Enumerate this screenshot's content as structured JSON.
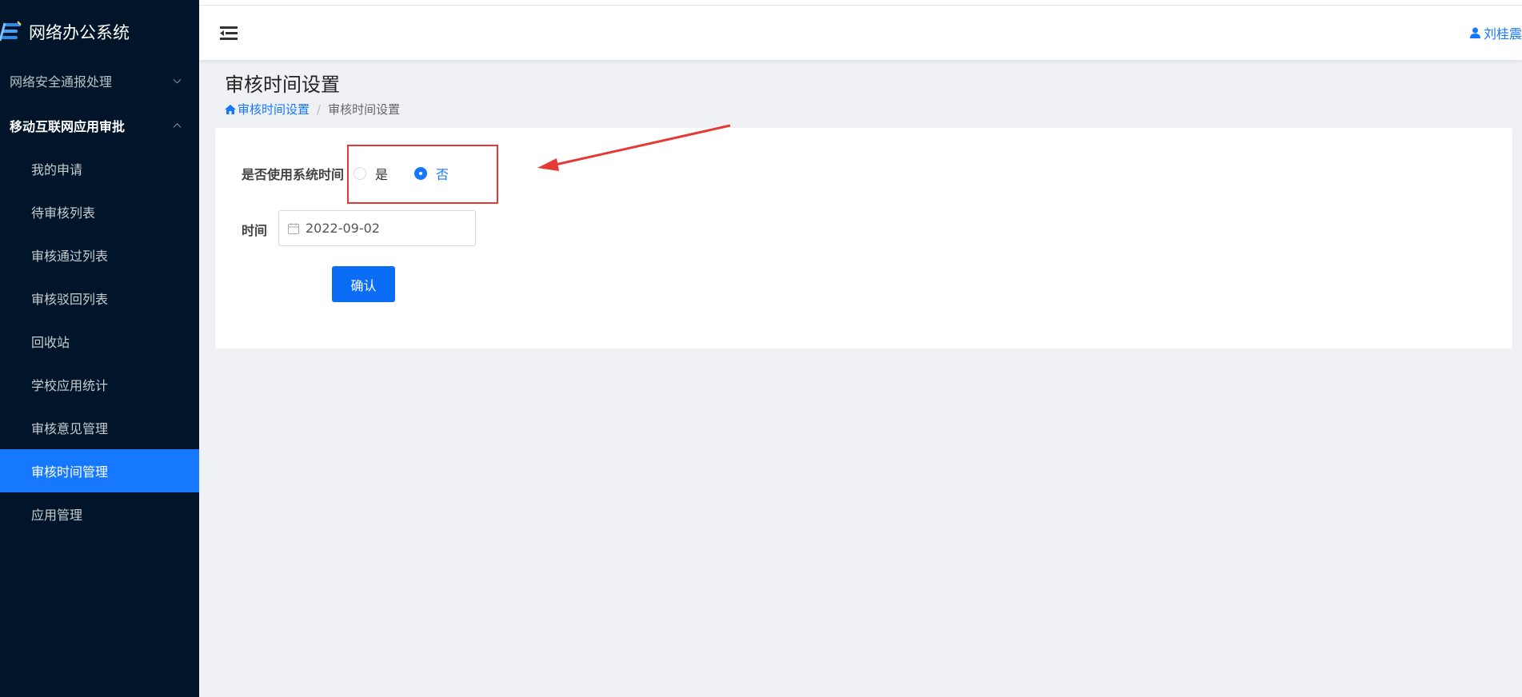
{
  "app": {
    "title": "网络办公系统"
  },
  "sidebar": {
    "groups": [
      {
        "label": "网络安全通报处理"
      },
      {
        "label": "移动互联网应用审批"
      }
    ],
    "items": [
      {
        "label": "我的申请"
      },
      {
        "label": "待审核列表"
      },
      {
        "label": "审核通过列表"
      },
      {
        "label": "审核驳回列表"
      },
      {
        "label": "回收站"
      },
      {
        "label": "学校应用统计"
      },
      {
        "label": "审核意见管理"
      },
      {
        "label": "审核时间管理"
      },
      {
        "label": "应用管理"
      }
    ]
  },
  "header": {
    "user_name": "刘桂震"
  },
  "page": {
    "title": "审核时间设置",
    "breadcrumb": {
      "link": "审核时间设置",
      "current": "审核时间设置"
    }
  },
  "form": {
    "use_system_time_label": "是否使用系统时间",
    "options": [
      {
        "label": "是"
      },
      {
        "label": "否"
      }
    ],
    "selected": "否",
    "time_label": "时间",
    "time_value": "2022-09-02",
    "confirm_label": "确认"
  },
  "colors": {
    "accent": "#1677ff",
    "sidebar_bg": "#001529",
    "annotation": "#e53935"
  }
}
